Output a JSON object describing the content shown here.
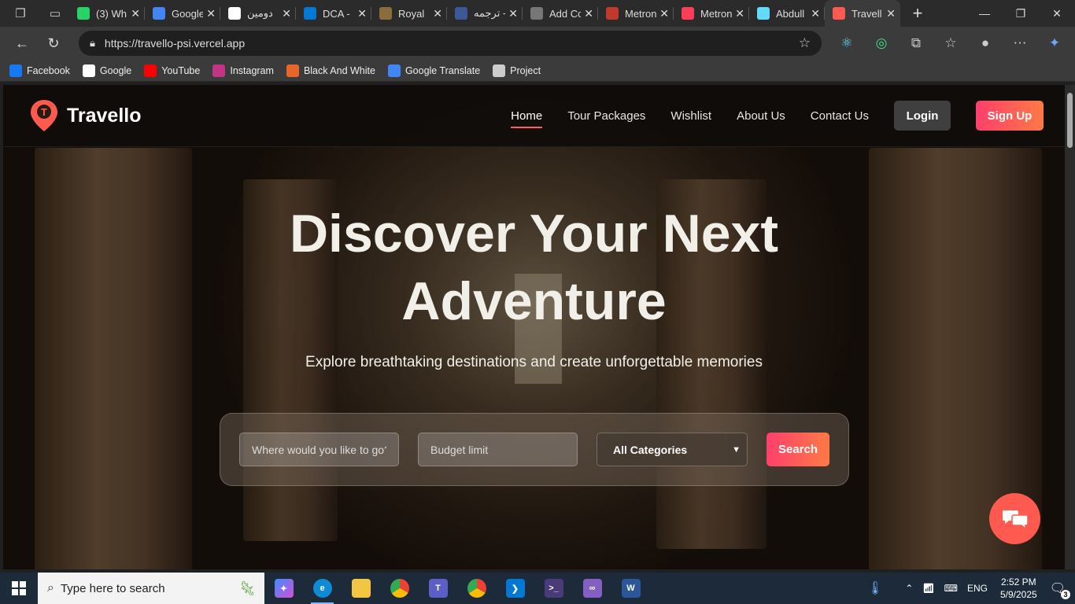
{
  "browser": {
    "tabs": [
      {
        "title": "(3) Wh",
        "icon": "whatsapp-icon",
        "color": "#25d366"
      },
      {
        "title": "Google",
        "icon": "google-drive-icon",
        "color": "#4285f4"
      },
      {
        "title": "دومين",
        "icon": "chatgpt-icon",
        "color": "#ffffff"
      },
      {
        "title": "DCA -",
        "icon": "vscode-icon",
        "color": "#0078d4"
      },
      {
        "title": "Royal",
        "icon": "royal-icon",
        "color": "#8a6d3b"
      },
      {
        "title": "ترجمه -",
        "icon": "search-icon",
        "color": "#3b5998"
      },
      {
        "title": "Add Cc",
        "icon": "page-icon",
        "color": "#777777"
      },
      {
        "title": "Metron",
        "icon": "metronic-icon",
        "color": "#c0392b"
      },
      {
        "title": "Metron",
        "icon": "metronic-icon",
        "color": "#ff3d57"
      },
      {
        "title": "Abdull",
        "icon": "react-icon",
        "color": "#61dafb"
      },
      {
        "title": "Travell",
        "icon": "travello-icon",
        "color": "#ff5a4f",
        "active": true
      }
    ],
    "url": "https://travello-psi.vercel.app",
    "bookmarks": [
      {
        "label": "Facebook",
        "icon": "facebook-icon",
        "color": "#1877f2"
      },
      {
        "label": "Google",
        "icon": "google-icon",
        "color": "#ffffff"
      },
      {
        "label": "YouTube",
        "icon": "youtube-icon",
        "color": "#ff0000"
      },
      {
        "label": "Instagram",
        "icon": "instagram-icon",
        "color": "#c13584"
      },
      {
        "label": "Black And White",
        "icon": "bw-icon",
        "color": "#e8652b"
      },
      {
        "label": "Google Translate",
        "icon": "translate-icon",
        "color": "#4285f4"
      },
      {
        "label": "Project",
        "icon": "folder-icon",
        "color": "#cccccc"
      }
    ]
  },
  "site": {
    "brand": "Travello",
    "nav": [
      "Home",
      "Tour Packages",
      "Wishlist",
      "About Us",
      "Contact Us"
    ],
    "login": "Login",
    "signup": "Sign Up",
    "hero_title_line1": "Discover Your Next",
    "hero_title_line2": "Adventure",
    "hero_subtitle": "Explore breathtaking destinations and create unforgettable memories",
    "search": {
      "destination_placeholder": "Where would you like to go?",
      "budget_placeholder": "Budget limit",
      "category_selected": "All Categories",
      "button": "Search"
    },
    "accent_color": "#ff4f5e"
  },
  "taskbar": {
    "search_placeholder": "Type here to search",
    "language": "ENG",
    "time": "2:52 PM",
    "date": "5/9/2025",
    "notification_count": "3"
  }
}
